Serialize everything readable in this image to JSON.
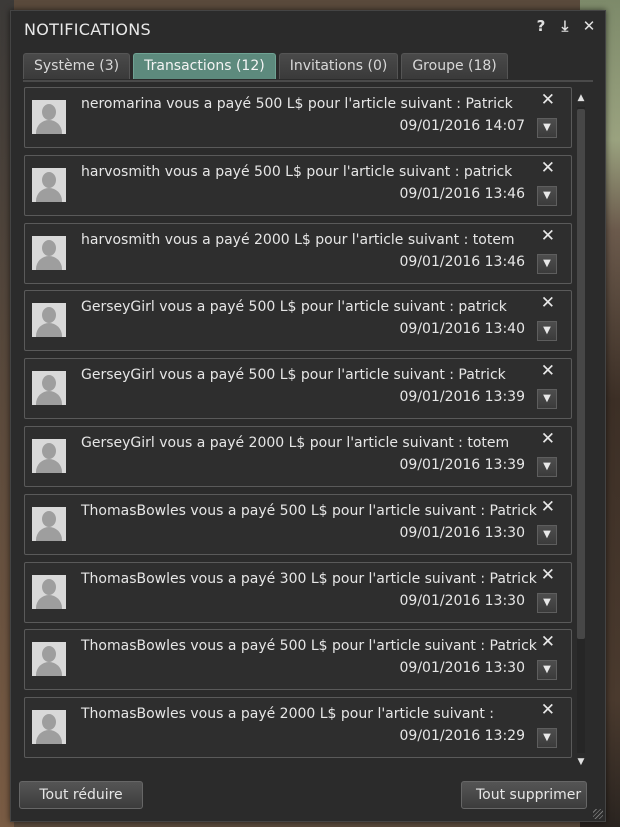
{
  "window": {
    "title": "NOTIFICATIONS",
    "icons": {
      "help": "?",
      "minimize": "⤓",
      "close": "✕"
    }
  },
  "tabs": [
    {
      "label": "Système (3)",
      "active": false
    },
    {
      "label": "Transactions (12)",
      "active": true
    },
    {
      "label": "Invitations (0)",
      "active": false
    },
    {
      "label": "Groupe (18)",
      "active": false
    }
  ],
  "notifications": [
    {
      "message": "neromarina vous a payé 500 L$ pour l'article suivant : Patrick",
      "time": "09/01/2016 14:07"
    },
    {
      "message": "harvosmith vous a payé 500 L$ pour l'article suivant : patrick",
      "time": "09/01/2016 13:46"
    },
    {
      "message": "harvosmith vous a payé 2000 L$ pour l'article suivant : totem",
      "time": "09/01/2016 13:46"
    },
    {
      "message": "GerseyGirl vous a payé 500 L$ pour l'article suivant : patrick",
      "time": "09/01/2016 13:40"
    },
    {
      "message": "GerseyGirl vous a payé 500 L$ pour l'article suivant : Patrick",
      "time": "09/01/2016 13:39"
    },
    {
      "message": "GerseyGirl vous a payé 2000 L$ pour l'article suivant : totem",
      "time": "09/01/2016 13:39"
    },
    {
      "message": "ThomasBowles vous a payé 500 L$ pour l'article suivant : Patrick",
      "time": "09/01/2016 13:30"
    },
    {
      "message": "ThomasBowles vous a payé 300 L$ pour l'article suivant : Patrick",
      "time": "09/01/2016 13:30"
    },
    {
      "message": "ThomasBowles vous a payé 500 L$ pour l'article suivant : Patrick",
      "time": "09/01/2016 13:30"
    },
    {
      "message": "ThomasBowles vous a payé 2000 L$ pour l'article suivant :",
      "time": "09/01/2016 13:29"
    }
  ],
  "footer": {
    "collapse_all": "Tout réduire",
    "delete_all": "Tout supprimer"
  },
  "colors": {
    "active_tab": "#5d8a7d",
    "panel_bg": "#2b2b2b"
  }
}
